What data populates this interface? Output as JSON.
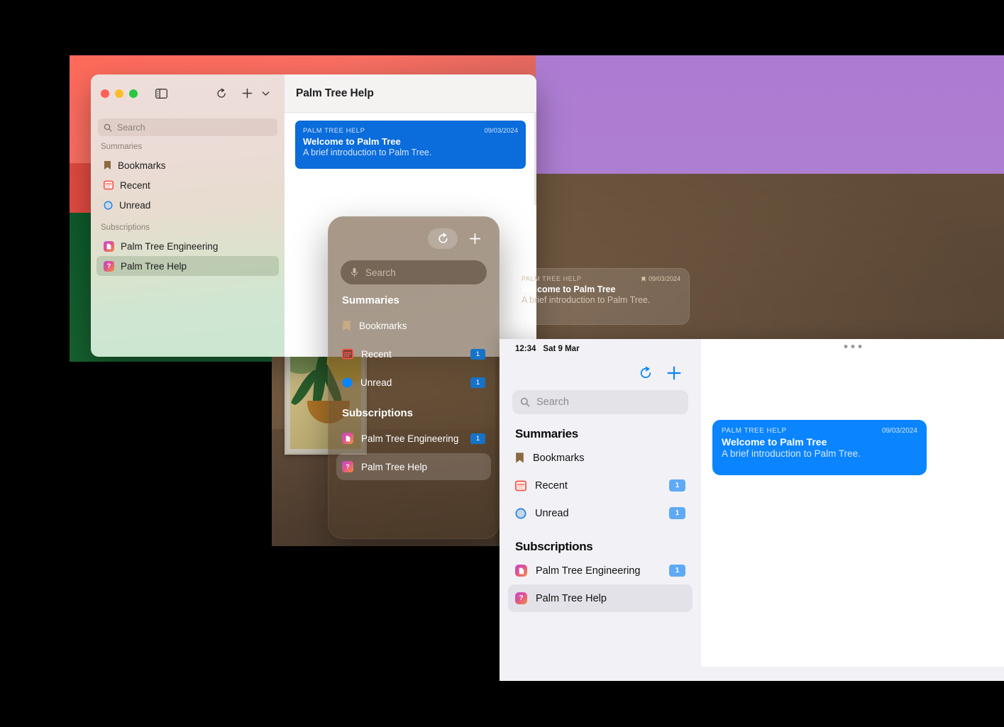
{
  "app": {
    "name": "Palm Tree",
    "accent_blue": "#0a84ff",
    "mac_message_blue": "#0b6cdb"
  },
  "mac_window": {
    "traffic_lights": [
      "close",
      "minimize",
      "zoom"
    ],
    "toolbar": {
      "sidebar_toggle": "sidebar-toggle-icon",
      "refresh": "refresh-icon",
      "add": "plus-icon",
      "add_menu": "chevron-down-icon"
    },
    "search": {
      "placeholder": "Search",
      "value": ""
    },
    "sections": [
      {
        "title": "Summaries",
        "items": [
          {
            "label": "Bookmarks",
            "icon": "bookmark-icon",
            "badge": ""
          },
          {
            "label": "Recent",
            "icon": "calendar-icon",
            "badge": ""
          },
          {
            "label": "Unread",
            "icon": "circle-icon",
            "badge": ""
          }
        ]
      },
      {
        "title": "Subscriptions",
        "items": [
          {
            "label": "Palm Tree Engineering",
            "icon": "document-app-icon",
            "glyph": "☷",
            "badge": "",
            "selected": false
          },
          {
            "label": "Palm Tree Help",
            "icon": "question-app-icon",
            "glyph": "?",
            "badge": "",
            "selected": true
          }
        ]
      }
    ],
    "detail": {
      "title": "Palm Tree Help",
      "message": {
        "source": "PALM TREE HELP",
        "date": "09/03/2024",
        "title": "Welcome to Palm Tree",
        "subtitle": "A brief introduction to Palm Tree."
      }
    }
  },
  "vision_window": {
    "toolbar": {
      "refresh": "refresh-icon",
      "add": "plus-icon"
    },
    "search": {
      "placeholder": "Search",
      "icon": "microphone-icon",
      "value": ""
    },
    "sections": [
      {
        "title": "Summaries",
        "items": [
          {
            "label": "Bookmarks",
            "icon": "bookmark-icon",
            "badge": ""
          },
          {
            "label": "Recent",
            "icon": "calendar-icon",
            "badge": "1"
          },
          {
            "label": "Unread",
            "icon": "circle-filled-icon",
            "badge": "1"
          }
        ]
      },
      {
        "title": "Subscriptions",
        "items": [
          {
            "label": "Palm Tree Engineering",
            "icon": "document-app-icon",
            "glyph": "☷",
            "badge": "1",
            "selected": false
          },
          {
            "label": "Palm Tree Help",
            "icon": "question-app-icon",
            "glyph": "?",
            "badge": "",
            "selected": true
          }
        ]
      }
    ],
    "card": {
      "source": "PALM TREE HELP",
      "date": "09/03/2024",
      "date_icon": "bookmark-icon",
      "title": "Welcome to Palm Tree",
      "subtitle": "A brief introduction to Palm Tree."
    }
  },
  "ios_window": {
    "status_bar": {
      "time": "12:34",
      "date": "Sat 9 Mar"
    },
    "toolbar": {
      "refresh": "refresh-icon",
      "add": "plus-icon"
    },
    "search": {
      "placeholder": "Search",
      "icon": "search-icon",
      "value": ""
    },
    "sections": [
      {
        "title": "Summaries",
        "items": [
          {
            "label": "Bookmarks",
            "icon": "bookmark-icon",
            "badge": ""
          },
          {
            "label": "Recent",
            "icon": "calendar-icon",
            "badge": "1"
          },
          {
            "label": "Unread",
            "icon": "circle-icon",
            "badge": "1"
          }
        ]
      },
      {
        "title": "Subscriptions",
        "items": [
          {
            "label": "Palm Tree Engineering",
            "icon": "document-app-icon",
            "glyph": "☷",
            "badge": "1",
            "selected": false
          },
          {
            "label": "Palm Tree Help",
            "icon": "question-app-icon",
            "glyph": "?",
            "badge": "",
            "selected": true
          }
        ]
      }
    ],
    "detail": {
      "grabber": "grabber-dots-icon",
      "message": {
        "source": "PALM TREE HELP",
        "date": "09/03/2024",
        "title": "Welcome to Palm Tree",
        "subtitle": "A brief introduction to Palm Tree."
      }
    }
  }
}
